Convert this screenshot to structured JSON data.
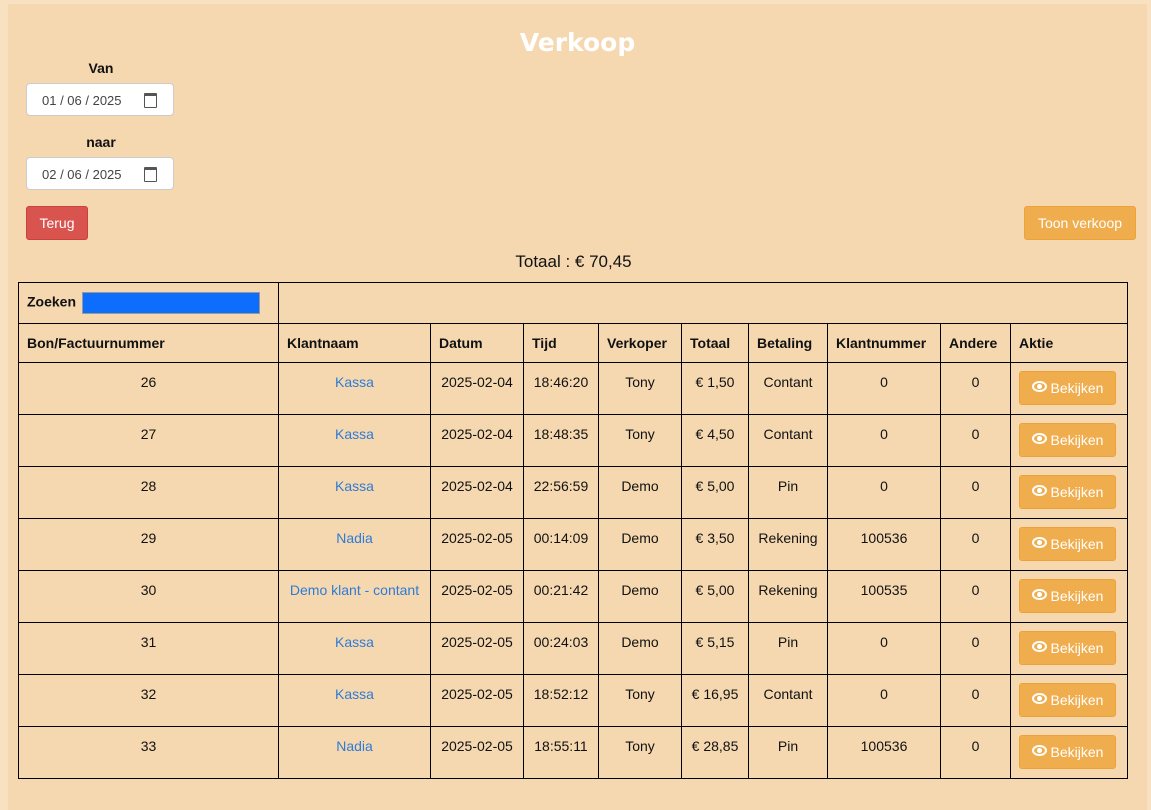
{
  "page": {
    "title": "Verkoop"
  },
  "filter": {
    "from_label": "Van",
    "from_value": "01 / 06 / 2025",
    "to_label": "naar",
    "to_value": "02 / 06 / 2025"
  },
  "buttons": {
    "back": "Terug",
    "show_sales": "Toon verkoop",
    "view": "Bekijken"
  },
  "total_text": "Totaal : € 70,45",
  "search": {
    "label": "Zoeken"
  },
  "columns": [
    "Bon/Factuurnummer",
    "Klantnaam",
    "Datum",
    "Tijd",
    "Verkoper",
    "Totaal",
    "Betaling",
    "Klantnummer",
    "Andere",
    "Aktie"
  ],
  "rows": [
    {
      "nr": "26",
      "klant": "Kassa",
      "datum": "2025-02-04",
      "tijd": "18:46:20",
      "verkoper": "Tony",
      "totaal": "€ 1,50",
      "betaling": "Contant",
      "klantnummer": "0",
      "andere": "0"
    },
    {
      "nr": "27",
      "klant": "Kassa",
      "datum": "2025-02-04",
      "tijd": "18:48:35",
      "verkoper": "Tony",
      "totaal": "€ 4,50",
      "betaling": "Contant",
      "klantnummer": "0",
      "andere": "0"
    },
    {
      "nr": "28",
      "klant": "Kassa",
      "datum": "2025-02-04",
      "tijd": "22:56:59",
      "verkoper": "Demo",
      "totaal": "€ 5,00",
      "betaling": "Pin",
      "klantnummer": "0",
      "andere": "0"
    },
    {
      "nr": "29",
      "klant": "Nadia",
      "datum": "2025-02-05",
      "tijd": "00:14:09",
      "verkoper": "Demo",
      "totaal": "€ 3,50",
      "betaling": "Rekening",
      "klantnummer": "100536",
      "andere": "0"
    },
    {
      "nr": "30",
      "klant": "Demo klant - contant",
      "datum": "2025-02-05",
      "tijd": "00:21:42",
      "verkoper": "Demo",
      "totaal": "€ 5,00",
      "betaling": "Rekening",
      "klantnummer": "100535",
      "andere": "0"
    },
    {
      "nr": "31",
      "klant": "Kassa",
      "datum": "2025-02-05",
      "tijd": "00:24:03",
      "verkoper": "Demo",
      "totaal": "€ 5,15",
      "betaling": "Pin",
      "klantnummer": "0",
      "andere": "0"
    },
    {
      "nr": "32",
      "klant": "Kassa",
      "datum": "2025-02-05",
      "tijd": "18:52:12",
      "verkoper": "Tony",
      "totaal": "€ 16,95",
      "betaling": "Contant",
      "klantnummer": "0",
      "andere": "0"
    },
    {
      "nr": "33",
      "klant": "Nadia",
      "datum": "2025-02-05",
      "tijd": "18:55:11",
      "verkoper": "Tony",
      "totaal": "€ 28,85",
      "betaling": "Pin",
      "klantnummer": "100536",
      "andere": "0"
    }
  ],
  "colors": {
    "background": "#f5d8b0",
    "danger": "#d9534f",
    "warning": "#f0ad4e",
    "link": "#2e7bd6",
    "search_fill": "#0d6efd"
  }
}
